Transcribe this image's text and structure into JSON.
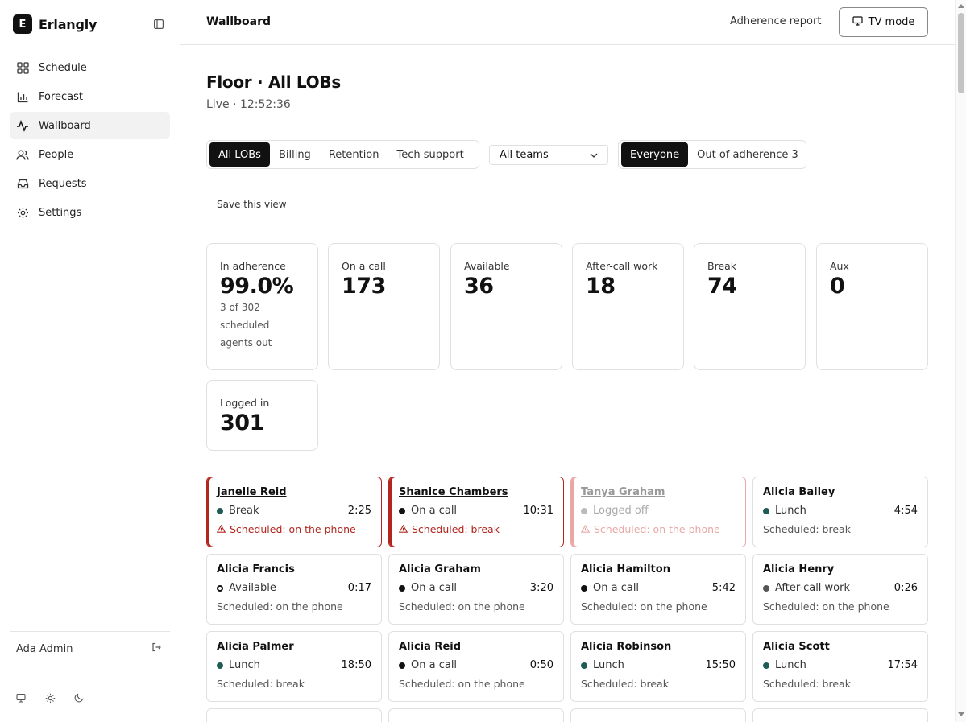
{
  "app": {
    "name": "Erlangly",
    "logo_letter": "E"
  },
  "sidebar": {
    "items": [
      {
        "label": "Schedule",
        "icon": "grid-icon"
      },
      {
        "label": "Forecast",
        "icon": "bar-chart-icon"
      },
      {
        "label": "Wallboard",
        "icon": "activity-icon",
        "active": true
      },
      {
        "label": "People",
        "icon": "users-icon"
      },
      {
        "label": "Requests",
        "icon": "inbox-icon"
      },
      {
        "label": "Settings",
        "icon": "gear-icon"
      }
    ],
    "user": "Ada Admin"
  },
  "header": {
    "title": "Wallboard",
    "report_link": "Adherence report",
    "tv_button": "TV mode"
  },
  "page": {
    "title": "Floor · All LOBs",
    "subtitle": "Live · 12:52:36"
  },
  "filters": {
    "lobs": [
      "All LOBs",
      "Billing",
      "Retention",
      "Tech support"
    ],
    "team_select": "All teams",
    "adherence": [
      "Everyone",
      "Out of adherence 3"
    ],
    "save_view": "Save this view"
  },
  "stats": [
    {
      "label": "In adherence",
      "value": "99.0%",
      "note": "3 of 302 scheduled agents out"
    },
    {
      "label": "On a call",
      "value": "173"
    },
    {
      "label": "Available",
      "value": "36"
    },
    {
      "label": "After-call work",
      "value": "18"
    },
    {
      "label": "Break",
      "value": "74"
    },
    {
      "label": "Aux",
      "value": "0"
    },
    {
      "label": "Logged in",
      "value": "301"
    }
  ],
  "colors": {
    "alert": "#b3261e",
    "teal": "#1f5c55",
    "black": "#111111",
    "gray": "#555555",
    "light": "#bbbbbb"
  },
  "agents": [
    {
      "name": "Janelle Reid",
      "state": "Break",
      "time": "2:25",
      "sched": "Scheduled: on the phone",
      "status": "alert",
      "dot": "teal"
    },
    {
      "name": "Shanice Chambers",
      "state": "On a call",
      "time": "10:31",
      "sched": "Scheduled: break",
      "status": "alert",
      "dot": "black"
    },
    {
      "name": "Tanya Graham",
      "state": "Logged off",
      "time": "",
      "sched": "Scheduled: on the phone",
      "status": "faded",
      "dot": "light"
    },
    {
      "name": "Alicia Bailey",
      "state": "Lunch",
      "time": "4:54",
      "sched": "Scheduled: break",
      "status": "ok",
      "dot": "teal"
    },
    {
      "name": "Alicia Francis",
      "state": "Available",
      "time": "0:17",
      "sched": "Scheduled: on the phone",
      "status": "ok",
      "dot": "ring"
    },
    {
      "name": "Alicia Graham",
      "state": "On a call",
      "time": "3:20",
      "sched": "Scheduled: on the phone",
      "status": "ok",
      "dot": "black"
    },
    {
      "name": "Alicia Hamilton",
      "state": "On a call",
      "time": "5:42",
      "sched": "Scheduled: on the phone",
      "status": "ok",
      "dot": "black"
    },
    {
      "name": "Alicia Henry",
      "state": "After-call work",
      "time": "0:26",
      "sched": "Scheduled: on the phone",
      "status": "ok",
      "dot": "gray"
    },
    {
      "name": "Alicia Palmer",
      "state": "Lunch",
      "time": "18:50",
      "sched": "Scheduled: break",
      "status": "ok",
      "dot": "teal"
    },
    {
      "name": "Alicia Reid",
      "state": "On a call",
      "time": "0:50",
      "sched": "Scheduled: on the phone",
      "status": "ok",
      "dot": "black"
    },
    {
      "name": "Alicia Robinson",
      "state": "Lunch",
      "time": "15:50",
      "sched": "Scheduled: break",
      "status": "ok",
      "dot": "teal"
    },
    {
      "name": "Alicia Scott",
      "state": "Lunch",
      "time": "17:54",
      "sched": "Scheduled: break",
      "status": "ok",
      "dot": "teal"
    }
  ]
}
